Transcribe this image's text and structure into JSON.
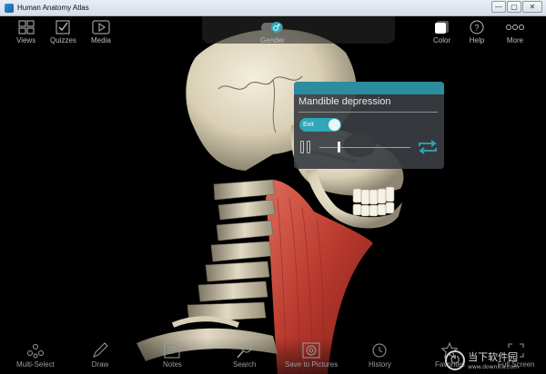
{
  "window": {
    "title": "Human Anatomy Atlas",
    "minimize_glyph": "—",
    "maximize_glyph": "▢",
    "close_glyph": "✕"
  },
  "topbar": {
    "views_label": "Views",
    "quizzes_label": "Quizzes",
    "media_label": "Media",
    "gender_label": "Gender",
    "color_label": "Color",
    "help_label": "Help",
    "more_label": "More"
  },
  "popup": {
    "title": "Mandible depression",
    "exit_label": "Exit"
  },
  "bottombar": {
    "multiselect_label": "Multi-Select",
    "draw_label": "Draw",
    "notes_label": "Notes",
    "search_label": "Search",
    "save_label": "Save to Pictures",
    "history_label": "History",
    "favorites_label": "Favorites",
    "fullscreen_label": "Full Screen"
  },
  "watermark": {
    "main": "当下软件园",
    "sub": "www.downxia.com"
  },
  "colors": {
    "accent": "#2fa8b8",
    "popup_header": "#2d8da0",
    "toolbar_text": "#b9bcc0"
  }
}
